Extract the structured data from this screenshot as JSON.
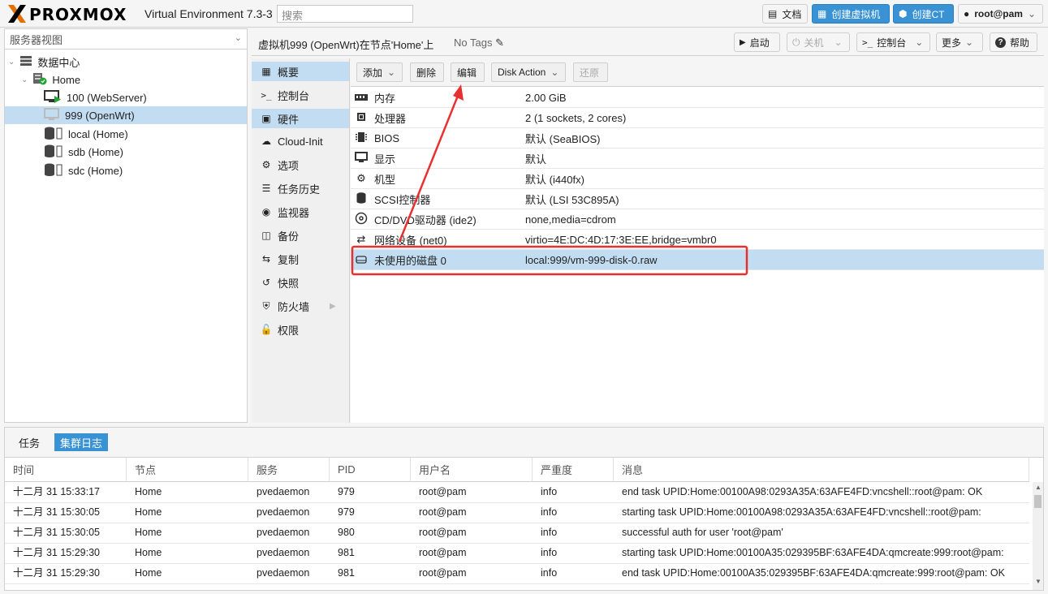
{
  "topbar": {
    "logo": "PROXMOX",
    "version": "Virtual Environment 7.3-3",
    "search_placeholder": "搜索",
    "docs_label": "文档",
    "create_vm_label": "创建虚拟机",
    "create_ct_label": "创建CT",
    "user_label": "root@pam"
  },
  "tree": {
    "view_label": "服务器视图",
    "items": [
      {
        "label": "数据中心"
      },
      {
        "label": "Home"
      },
      {
        "label": "100 (WebServer)"
      },
      {
        "label": "999 (OpenWrt)"
      },
      {
        "label": "local (Home)"
      },
      {
        "label": "sdb (Home)"
      },
      {
        "label": "sdc (Home)"
      }
    ]
  },
  "header": {
    "title": "虚拟机999 (OpenWrt)在节点'Home'上",
    "tags": "No Tags",
    "start_label": "启动",
    "shutdown_label": "关机",
    "console_label": "控制台",
    "more_label": "更多",
    "help_label": "帮助"
  },
  "nav": {
    "items": [
      {
        "label": "概要"
      },
      {
        "label": "控制台"
      },
      {
        "label": "硬件"
      },
      {
        "label": "Cloud-Init"
      },
      {
        "label": "选项"
      },
      {
        "label": "任务历史"
      },
      {
        "label": "监视器"
      },
      {
        "label": "备份"
      },
      {
        "label": "复制"
      },
      {
        "label": "快照"
      },
      {
        "label": "防火墙"
      },
      {
        "label": "权限"
      }
    ]
  },
  "hw_toolbar": {
    "add_label": "添加",
    "remove_label": "删除",
    "edit_label": "编辑",
    "disk_action_label": "Disk Action",
    "revert_label": "还原"
  },
  "hardware": [
    {
      "name": "内存",
      "value": "2.00 GiB"
    },
    {
      "name": "处理器",
      "value": "2 (1 sockets, 2 cores)"
    },
    {
      "name": "BIOS",
      "value": "默认 (SeaBIOS)"
    },
    {
      "name": "显示",
      "value": "默认"
    },
    {
      "name": "机型",
      "value": "默认 (i440fx)"
    },
    {
      "name": "SCSI控制器",
      "value": "默认 (LSI 53C895A)"
    },
    {
      "name": "CD/DVD驱动器 (ide2)",
      "value": "none,media=cdrom"
    },
    {
      "name": "网络设备 (net0)",
      "value": "virtio=4E:DC:4D:17:3E:EE,bridge=vmbr0"
    },
    {
      "name": "未使用的磁盘 0",
      "value": "local:999/vm-999-disk-0.raw"
    }
  ],
  "log": {
    "tab_tasks": "任务",
    "tab_cluster": "集群日志",
    "columns": [
      "时间",
      "节点",
      "服务",
      "PID",
      "用户名",
      "严重度",
      "消息"
    ],
    "rows": [
      [
        "十二月 31 15:33:17",
        "Home",
        "pvedaemon",
        "979",
        "root@pam",
        "info",
        "end task UPID:Home:00100A98:0293A35A:63AFE4FD:vncshell::root@pam: OK"
      ],
      [
        "十二月 31 15:30:05",
        "Home",
        "pvedaemon",
        "979",
        "root@pam",
        "info",
        "starting task UPID:Home:00100A98:0293A35A:63AFE4FD:vncshell::root@pam:"
      ],
      [
        "十二月 31 15:30:05",
        "Home",
        "pvedaemon",
        "980",
        "root@pam",
        "info",
        "successful auth for user 'root@pam'"
      ],
      [
        "十二月 31 15:29:30",
        "Home",
        "pvedaemon",
        "981",
        "root@pam",
        "info",
        "starting task UPID:Home:00100A35:029395BF:63AFE4DA:qmcreate:999:root@pam:"
      ],
      [
        "十二月 31 15:29:30",
        "Home",
        "pvedaemon",
        "981",
        "root@pam",
        "info",
        "end task UPID:Home:00100A35:029395BF:63AFE4DA:qmcreate:999:root@pam: OK"
      ]
    ]
  },
  "colors": {
    "accent": "#3892d4",
    "selected": "#c2ddf2",
    "highlight": "#e83030",
    "logo_orange": "#e57000"
  }
}
